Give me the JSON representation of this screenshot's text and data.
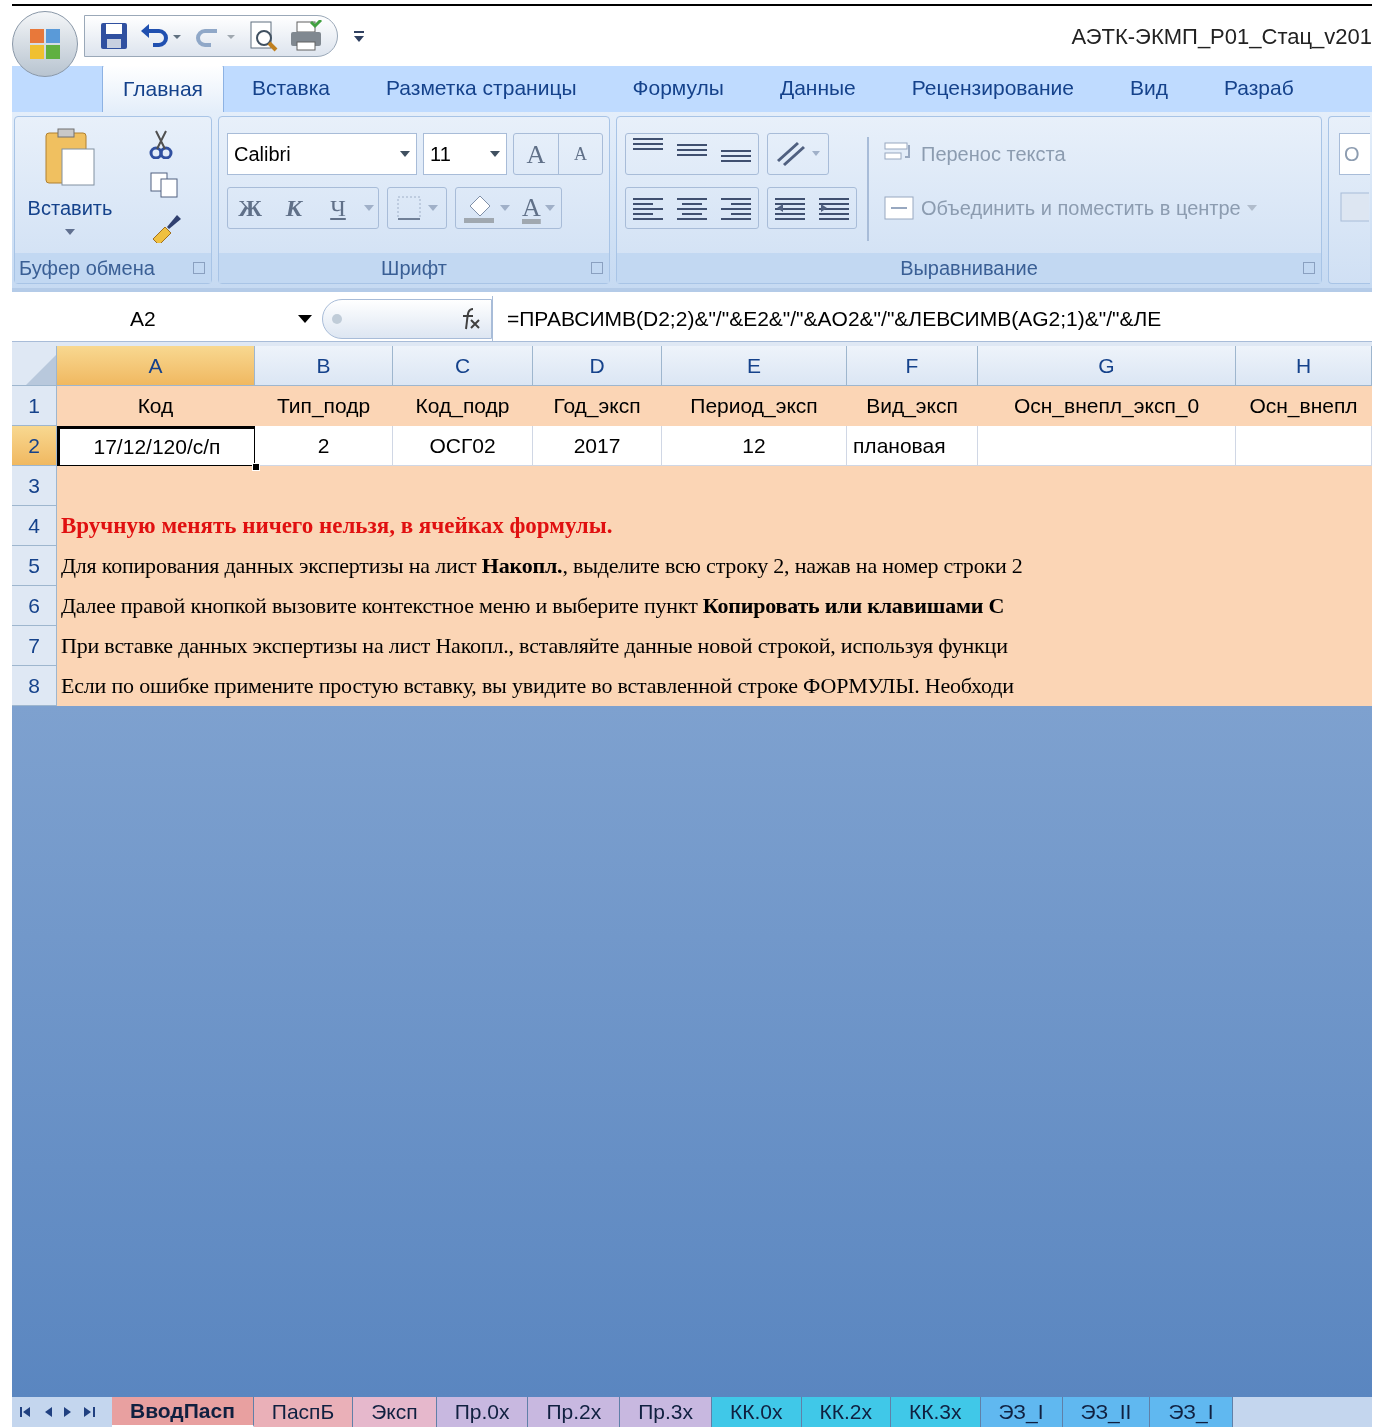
{
  "title": "АЭТК-ЭКМП_Р01_Стац_v201",
  "tabs": [
    {
      "label": "Главная",
      "selected": true
    },
    {
      "label": "Вставка",
      "selected": false
    },
    {
      "label": "Разметка страницы",
      "selected": false
    },
    {
      "label": "Формулы",
      "selected": false
    },
    {
      "label": "Данные",
      "selected": false
    },
    {
      "label": "Рецензирование",
      "selected": false
    },
    {
      "label": "Вид",
      "selected": false
    },
    {
      "label": "Разраб",
      "selected": false
    }
  ],
  "ribbon": {
    "clipboard": {
      "paste_label": "Вставить",
      "group_label": "Буфер обмена"
    },
    "font": {
      "name": "Calibri",
      "size": "11",
      "grow": "A",
      "shrink": "A",
      "styles": [
        "Ж",
        "К",
        "Ч"
      ],
      "font_color": "A",
      "group_label": "Шрифт"
    },
    "alignment": {
      "wrap": "Перенос текста",
      "merge": "Объединить и поместить в центре",
      "disabled": true,
      "group_label": "Выравнивание"
    },
    "next_group_field": "О"
  },
  "formula_bar": {
    "name_box": "A2",
    "formula": "=ПРАВСИМВ(D2;2)&\"/\"&E2&\"/\"&AO2&\"/\"&ЛЕВСИМВ(AG2;1)&\"/\"&ЛЕ"
  },
  "columns": [
    {
      "label": "A",
      "selected": true
    },
    {
      "label": "B",
      "selected": false
    },
    {
      "label": "C",
      "selected": false
    },
    {
      "label": "D",
      "selected": false
    },
    {
      "label": "E",
      "selected": false
    },
    {
      "label": "F",
      "selected": false
    },
    {
      "label": "G",
      "selected": false
    },
    {
      "label": "H",
      "selected": false
    }
  ],
  "rows": [
    {
      "number": "1",
      "kind": "cells",
      "selected": false,
      "cells": [
        "Код",
        "Тип_подр",
        "Код_подр",
        "Год_эксп",
        "Период_эксп",
        "Вид_эксп",
        "Осн_внепл_эксп_0",
        "Осн_внепл"
      ]
    },
    {
      "number": "2",
      "kind": "cells",
      "selected": true,
      "cells": [
        "17/12/120/с/п",
        "2",
        "ОСГ02",
        "2017",
        "12",
        "плановая",
        "",
        ""
      ]
    },
    {
      "number": "3",
      "kind": "empty"
    },
    {
      "number": "4",
      "kind": "warning",
      "text": "Вручную менять ничего нельзя, в ячейках формулы."
    },
    {
      "number": "5",
      "kind": "note",
      "text": "Для копирования данных экспертизы на лист **Накопл.**, выделите всю строку 2, нажав на номер строки 2"
    },
    {
      "number": "6",
      "kind": "note",
      "text": "Далее правой кнопкой вызовите контекстное меню и выберите пункт **Копировать или клавишами C**"
    },
    {
      "number": "7",
      "kind": "note",
      "text": "При вставке данных экспертизы на лист Накопл., вставляйте данные новой строкой, используя функци"
    },
    {
      "number": "8",
      "kind": "note",
      "text": "Если по ошибке примените простую вставку, вы увидите во вставленной строке ФОРМУЛЫ. Необходи"
    }
  ],
  "sheet_tabs": [
    {
      "label": "ВводПасп",
      "color": "#e8a0a0",
      "selected": true
    },
    {
      "label": "ПаспБ",
      "color": "#eab0b8",
      "selected": false
    },
    {
      "label": "Эксп",
      "color": "#e6b8cc",
      "selected": false
    },
    {
      "label": "Пр.0х",
      "color": "#c8b8e0",
      "selected": false
    },
    {
      "label": "Пр.2х",
      "color": "#c8b8e0",
      "selected": false
    },
    {
      "label": "Пр.3х",
      "color": "#c8b8e0",
      "selected": false
    },
    {
      "label": "КК.0х",
      "color": "#40c8e8",
      "selected": false
    },
    {
      "label": "КК.2х",
      "color": "#40c8e8",
      "selected": false
    },
    {
      "label": "КК.3х",
      "color": "#40c8e8",
      "selected": false
    },
    {
      "label": "ЭЗ_I",
      "color": "#60b8f0",
      "selected": false
    },
    {
      "label": "ЭЗ_II",
      "color": "#60b8f0",
      "selected": false
    },
    {
      "label": "ЭЗ_I",
      "color": "#60b8f0",
      "selected": false
    }
  ]
}
